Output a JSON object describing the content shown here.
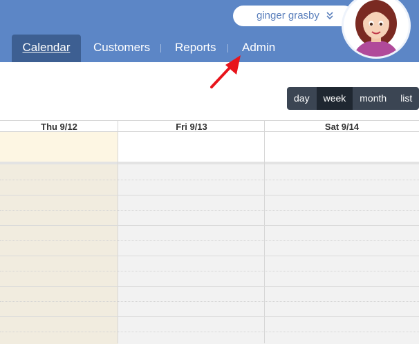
{
  "nav": {
    "tabs": [
      {
        "label": "Calendar",
        "active": true
      },
      {
        "label": "Customers",
        "active": false
      },
      {
        "label": "Reports",
        "active": false
      },
      {
        "label": "Admin",
        "active": false
      }
    ]
  },
  "user": {
    "name": "ginger grasby",
    "menu_icon": "double-chevron-down-icon"
  },
  "view_switch": {
    "buttons": [
      {
        "label": "day",
        "active": false
      },
      {
        "label": "week",
        "active": true
      },
      {
        "label": "month",
        "active": false
      },
      {
        "label": "list",
        "active": false
      }
    ]
  },
  "calendar": {
    "columns": [
      {
        "label": "Thu 9/12",
        "today": true
      },
      {
        "label": "Fri 9/13",
        "today": false
      },
      {
        "label": "Sat 9/14",
        "today": false
      }
    ]
  },
  "colors": {
    "header": "#5c86c6",
    "active_tab": "#3d5f92",
    "today_allday": "#fdf6e3",
    "today_body": "#f1ecdf",
    "grid_body": "#f2f2f2",
    "annotation_arrow": "#e8141b"
  }
}
